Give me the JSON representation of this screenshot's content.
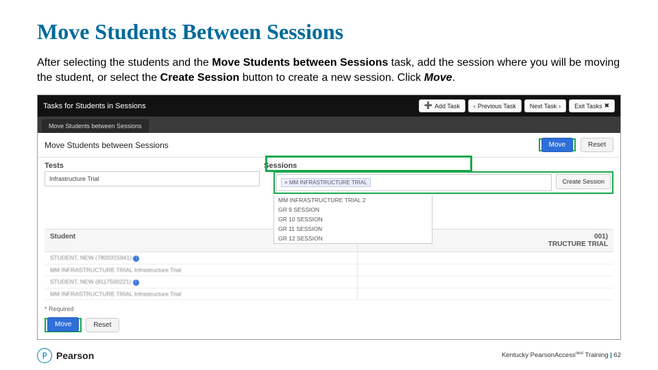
{
  "title": "Move Students Between Sessions",
  "intro": {
    "t1": "After selecting the students and the ",
    "b1": "Move Students between Sessions",
    "t2": " task, add the session where you will be moving the student, or select the ",
    "b2": "Create Session",
    "t3": " button to create a new session. Click ",
    "b3": "Move",
    "t4": "."
  },
  "shot": {
    "header": "Tasks for Students in Sessions",
    "buttons": {
      "add": "Add Task",
      "prev": "Previous Task",
      "next": "Next Task",
      "exit": "Exit Tasks"
    },
    "tab": "Move Students between Sessions",
    "secTitle": "Move Students between Sessions",
    "move": "Move",
    "reset": "Reset",
    "labels": {
      "tests": "Tests",
      "sessions": "Sessions"
    },
    "testsField": "Infrastructure Trial",
    "sessionTag": "× MM INFRASTRUCTURE TRIAL",
    "createSession": "Create Session",
    "dropdown": [
      "MM INFRASTRUCTURE TRIAL 2",
      "GR 9 SESSION",
      "GR 10 SESSION",
      "GR 11 SESSION",
      "GR 12 SESSION"
    ],
    "gridHead": {
      "student": "Student",
      "c2": "TRUCTURE TRIAL",
      "c2suffix": "001)"
    },
    "rows": [
      {
        "name": "STUDENT, NEW (7800315941)",
        "sub": "MM INFRASTRUCTURE TRIAL Infrastructure Trial"
      },
      {
        "name": "STUDENT, NEW (8117500221)",
        "sub": "MM INFRASTRUCTURE TRIAL Infrastructure Trial"
      }
    ],
    "required": "* Required"
  },
  "footer": {
    "brand": "Pearson",
    "right_a": "Kentucky PearsonAccess",
    "right_b": " Training",
    "sep": " | ",
    "page": "62",
    "sup": "next"
  }
}
